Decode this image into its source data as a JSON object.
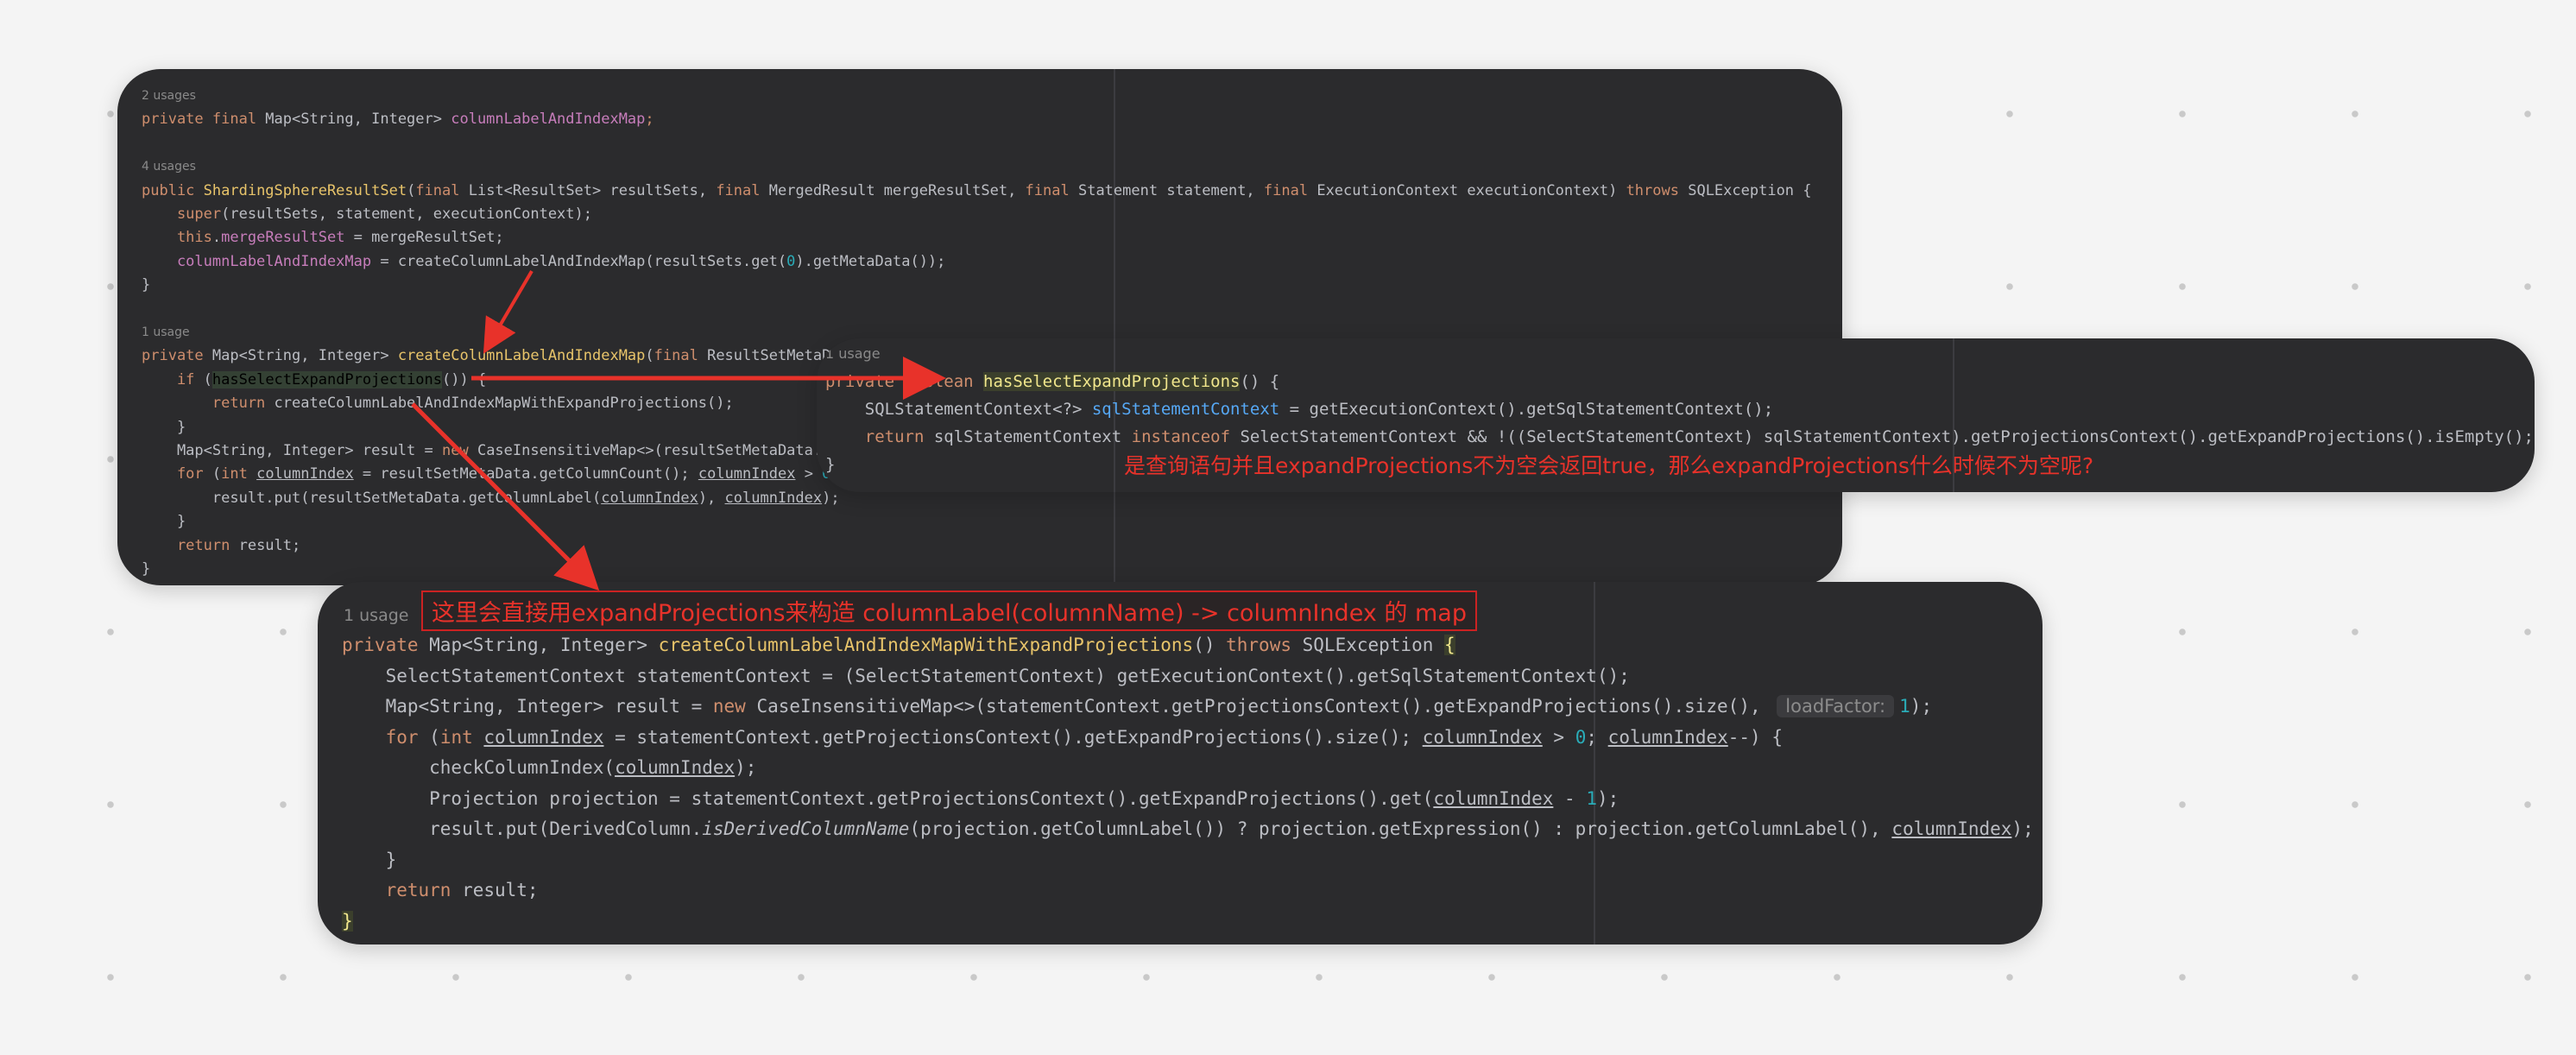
{
  "panel1": {
    "lines": [
      {
        "type": "usage",
        "text": "2 usages"
      },
      {
        "type": "code",
        "tokens": [
          {
            "t": "private final ",
            "c": "kw"
          },
          {
            "t": "Map<String, Integer> ",
            "c": "plain"
          },
          {
            "t": "columnLabelAndIndexMap",
            "c": "field"
          },
          {
            "t": ";",
            "c": "kw"
          }
        ]
      },
      {
        "type": "blank"
      },
      {
        "type": "usage",
        "text": "4 usages"
      },
      {
        "type": "code",
        "tokens": [
          {
            "t": "public ",
            "c": "kw"
          },
          {
            "t": "ShardingSphereResultSet",
            "c": "fnd"
          },
          {
            "t": "(",
            "c": "plain"
          },
          {
            "t": "final ",
            "c": "kw"
          },
          {
            "t": "List<ResultSet> resultSets, ",
            "c": "plain"
          },
          {
            "t": "final ",
            "c": "kw"
          },
          {
            "t": "MergedResult mergeResultSet, ",
            "c": "plain"
          },
          {
            "t": "final ",
            "c": "kw"
          },
          {
            "t": "Statement statement, ",
            "c": "plain"
          },
          {
            "t": "final ",
            "c": "kw"
          },
          {
            "t": "ExecutionContext executionContext) ",
            "c": "plain"
          },
          {
            "t": "throws ",
            "c": "kw"
          },
          {
            "t": "SQLException {",
            "c": "plain"
          }
        ]
      },
      {
        "type": "code",
        "tokens": [
          {
            "t": "    super",
            "c": "kw"
          },
          {
            "t": "(resultSets, statement, executionContext);",
            "c": "plain"
          }
        ]
      },
      {
        "type": "code",
        "tokens": [
          {
            "t": "    this",
            "c": "kw"
          },
          {
            "t": ".",
            "c": "plain"
          },
          {
            "t": "mergeResultSet",
            "c": "field"
          },
          {
            "t": " = mergeResultSet;",
            "c": "plain"
          }
        ]
      },
      {
        "type": "code",
        "tokens": [
          {
            "t": "    columnLabelAndIndexMap",
            "c": "field"
          },
          {
            "t": " = createColumnLabelAndIndexMap(resultSets.get(",
            "c": "plain"
          },
          {
            "t": "0",
            "c": "num"
          },
          {
            "t": ").getMetaData());",
            "c": "plain"
          }
        ]
      },
      {
        "type": "code",
        "tokens": [
          {
            "t": "}",
            "c": "plain"
          }
        ]
      },
      {
        "type": "blank"
      },
      {
        "type": "usage",
        "text": "1 usage"
      },
      {
        "type": "code",
        "tokens": [
          {
            "t": "private ",
            "c": "kw"
          },
          {
            "t": "Map<String, Integer> ",
            "c": "plain"
          },
          {
            "t": "createColumnLabelAndIndexMap",
            "c": "fnd"
          },
          {
            "t": "(",
            "c": "plain"
          },
          {
            "t": "final ",
            "c": "kw"
          },
          {
            "t": "ResultSetMetaData ",
            "c": "plain"
          }
        ]
      },
      {
        "type": "code",
        "tokens": [
          {
            "t": "    if ",
            "c": "kw"
          },
          {
            "t": "(",
            "c": "plain"
          },
          {
            "t": "hasSelectExpandProjections",
            "c": "hl"
          },
          {
            "t": "()) {",
            "c": "plain"
          }
        ]
      },
      {
        "type": "code",
        "tokens": [
          {
            "t": "        return ",
            "c": "kw"
          },
          {
            "t": "createColumnLabelAndIndexMapWithExpandProjections();",
            "c": "plain"
          }
        ]
      },
      {
        "type": "code",
        "tokens": [
          {
            "t": "    }",
            "c": "plain"
          }
        ]
      },
      {
        "type": "code",
        "tokens": [
          {
            "t": "    Map<String, Integer> result = ",
            "c": "plain"
          },
          {
            "t": "new ",
            "c": "kw"
          },
          {
            "t": "CaseInsensitiveMap<>(resultSetMetaData.get",
            "c": "plain"
          }
        ]
      },
      {
        "type": "code",
        "tokens": [
          {
            "t": "    for ",
            "c": "kw"
          },
          {
            "t": "(",
            "c": "plain"
          },
          {
            "t": "int ",
            "c": "kw"
          },
          {
            "t": "columnIndex",
            "c": "param"
          },
          {
            "t": " = resultSetMetaData.getColumnCount(); ",
            "c": "plain"
          },
          {
            "t": "columnIndex",
            "c": "param"
          },
          {
            "t": " > ",
            "c": "plain"
          },
          {
            "t": "0",
            "c": "num"
          },
          {
            "t": "; co",
            "c": "plain"
          }
        ]
      },
      {
        "type": "code",
        "tokens": [
          {
            "t": "        result.put(resultSetMetaData.getColumnLabel(",
            "c": "plain"
          },
          {
            "t": "columnIndex",
            "c": "param"
          },
          {
            "t": "), ",
            "c": "plain"
          },
          {
            "t": "columnIndex",
            "c": "param"
          },
          {
            "t": ");",
            "c": "plain"
          }
        ]
      },
      {
        "type": "code",
        "tokens": [
          {
            "t": "    }",
            "c": "plain"
          }
        ]
      },
      {
        "type": "code",
        "tokens": [
          {
            "t": "    return ",
            "c": "kw"
          },
          {
            "t": "result;",
            "c": "plain"
          }
        ]
      },
      {
        "type": "code",
        "tokens": [
          {
            "t": "}",
            "c": "plain"
          }
        ]
      }
    ]
  },
  "panel2": {
    "lines": [
      {
        "type": "usage",
        "text": "1 usage"
      },
      {
        "type": "code",
        "tokens": [
          {
            "t": "private ",
            "c": "kw"
          },
          {
            "t": "boolean ",
            "c": "kw"
          },
          {
            "t": "hasSelectExpandProjections",
            "c": "cursor"
          },
          {
            "t": "() {",
            "c": "plain"
          }
        ]
      },
      {
        "type": "code",
        "tokens": [
          {
            "t": "    SQLStatementContext<?> ",
            "c": "plain"
          },
          {
            "t": "sqlStatementContext",
            "c": "fn"
          },
          {
            "t": " = getExecutionContext().getSqlStatementContext();",
            "c": "plain"
          }
        ]
      },
      {
        "type": "code",
        "tokens": [
          {
            "t": "    return ",
            "c": "kw"
          },
          {
            "t": "sqlStatementContext ",
            "c": "plain"
          },
          {
            "t": "instanceof ",
            "c": "kw"
          },
          {
            "t": "SelectStatementContext && !((SelectStatementContext) sqlStatementContext).getProjectionsContext().getExpandProjections().isEmpty();",
            "c": "plain"
          }
        ]
      },
      {
        "type": "code",
        "tokens": [
          {
            "t": "}",
            "c": "plain"
          }
        ]
      }
    ],
    "note": "是查询语句并且expandProjections不为空会返回true，那么expandProjections什么时候不为空呢?"
  },
  "panel3": {
    "usage": "1 usage",
    "note": "这里会直接用expandProjections来构造 columnLabel(columnName) -> columnIndex 的 map",
    "lines": [
      {
        "type": "code",
        "tokens": [
          {
            "t": "private ",
            "c": "kw"
          },
          {
            "t": "Map<String, Integer> ",
            "c": "plain"
          },
          {
            "t": "createColumnLabelAndIndexMapWithExpandProjections",
            "c": "fnd"
          },
          {
            "t": "() ",
            "c": "plain"
          },
          {
            "t": "throws ",
            "c": "kw"
          },
          {
            "t": "SQLException ",
            "c": "plain"
          },
          {
            "t": "{",
            "c": "cursor"
          }
        ]
      },
      {
        "type": "code",
        "tokens": [
          {
            "t": "    SelectStatementContext statementContext = (SelectStatementContext) getExecutionContext().getSqlStatementContext();",
            "c": "plain"
          }
        ]
      },
      {
        "type": "code",
        "tokens": [
          {
            "t": "    Map<String, Integer> result = ",
            "c": "plain"
          },
          {
            "t": "new ",
            "c": "kw"
          },
          {
            "t": "CaseInsensitiveMap<>(statementContext.getProjectionsContext().getExpandProjections().size(), ",
            "c": "plain"
          },
          {
            "t": "loadFactor:",
            "c": "hint"
          },
          {
            "t": "1",
            "c": "num"
          },
          {
            "t": ");",
            "c": "plain"
          }
        ]
      },
      {
        "type": "code",
        "tokens": [
          {
            "t": "    for ",
            "c": "kw"
          },
          {
            "t": "(",
            "c": "plain"
          },
          {
            "t": "int ",
            "c": "kw"
          },
          {
            "t": "columnIndex",
            "c": "param"
          },
          {
            "t": " = statementContext.getProjectionsContext().getExpandProjections().size(); ",
            "c": "plain"
          },
          {
            "t": "columnIndex",
            "c": "param"
          },
          {
            "t": " > ",
            "c": "plain"
          },
          {
            "t": "0",
            "c": "num"
          },
          {
            "t": "; ",
            "c": "plain"
          },
          {
            "t": "columnIndex",
            "c": "param"
          },
          {
            "t": "--) {",
            "c": "plain"
          }
        ]
      },
      {
        "type": "code",
        "tokens": [
          {
            "t": "        checkColumnIndex(",
            "c": "plain"
          },
          {
            "t": "columnIndex",
            "c": "param"
          },
          {
            "t": ");",
            "c": "plain"
          }
        ]
      },
      {
        "type": "code",
        "tokens": [
          {
            "t": "        Projection projection = statementContext.getProjectionsContext().getExpandProjections().get(",
            "c": "plain"
          },
          {
            "t": "columnIndex",
            "c": "param"
          },
          {
            "t": " - ",
            "c": "plain"
          },
          {
            "t": "1",
            "c": "num"
          },
          {
            "t": ");",
            "c": "plain"
          }
        ]
      },
      {
        "type": "code",
        "tokens": [
          {
            "t": "        result.put(DerivedColumn.",
            "c": "plain"
          },
          {
            "t": "isDerivedColumnName",
            "c": "italic"
          },
          {
            "t": "(projection.getColumnLabel()) ? projection.getExpression() : projection.getColumnLabel(), ",
            "c": "plain"
          },
          {
            "t": "columnIndex",
            "c": "param"
          },
          {
            "t": ");",
            "c": "plain"
          }
        ]
      },
      {
        "type": "code",
        "tokens": [
          {
            "t": "    }",
            "c": "plain"
          }
        ]
      },
      {
        "type": "code",
        "tokens": [
          {
            "t": "    return ",
            "c": "kw"
          },
          {
            "t": "result;",
            "c": "plain"
          }
        ]
      },
      {
        "type": "code",
        "tokens": [
          {
            "t": "}",
            "c": "cursor"
          }
        ]
      }
    ]
  }
}
